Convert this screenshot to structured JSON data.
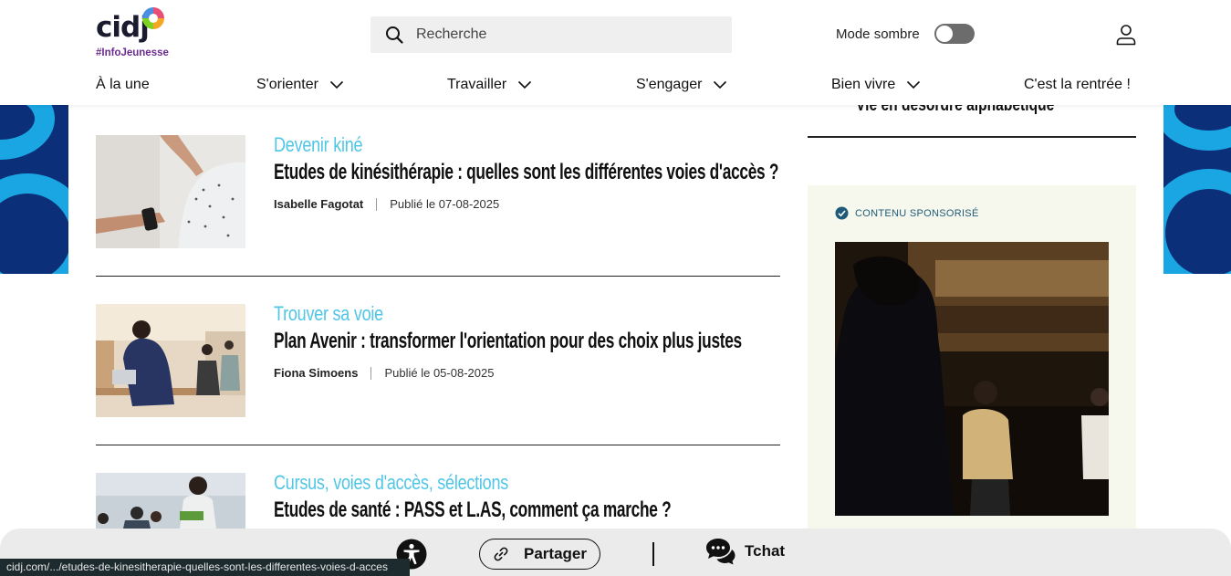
{
  "header": {
    "logo_text": "cidj",
    "logo_tagline": "#InfoJeunesse",
    "search_placeholder": "Recherche",
    "dark_mode_label": "Mode sombre",
    "dark_mode_enabled": false
  },
  "nav": {
    "items": [
      {
        "label": "À la une",
        "has_dropdown": false
      },
      {
        "label": "S'orienter",
        "has_dropdown": true
      },
      {
        "label": "Travailler",
        "has_dropdown": true
      },
      {
        "label": "S'engager",
        "has_dropdown": true
      },
      {
        "label": "Bien vivre",
        "has_dropdown": true
      },
      {
        "label": "C'est la rentrée !",
        "has_dropdown": false
      }
    ]
  },
  "articles": [
    {
      "category": "Devenir kiné",
      "title": "Etudes de kinésithérapie : quelles sont les différentes voies d'accès ?",
      "author": "Isabelle Fagotat",
      "published": "Publié le 07-08-2025"
    },
    {
      "category": "Trouver sa voie",
      "title": "Plan Avenir : transformer l'orientation pour des choix plus justes",
      "author": "Fiona Simoens",
      "published": "Publié le 05-08-2025"
    },
    {
      "category": "Cursus, voies d'accès, sélections",
      "title": "Etudes de santé : PASS et L.AS, comment ça marche ?",
      "author": "",
      "published": ""
    }
  ],
  "sidebar": {
    "top_article_title": "Vie en désordre alphabétique",
    "sponsored_label": "CONTENU SPONSORISÉ"
  },
  "bottom_bar": {
    "share_label": "Partager",
    "chat_label": "Tchat"
  },
  "status_bar": {
    "url": "cidj.com/.../etudes-de-kinesitherapie-quelles-sont-les-differentes-voies-d-acces"
  },
  "colors": {
    "category": "#4fc6e6",
    "deco_blue": "#0c2f7a",
    "deco_cyan": "#1aa6e3",
    "tagline": "#6b2d8f",
    "sponsor_bg": "#f6f8ee"
  }
}
